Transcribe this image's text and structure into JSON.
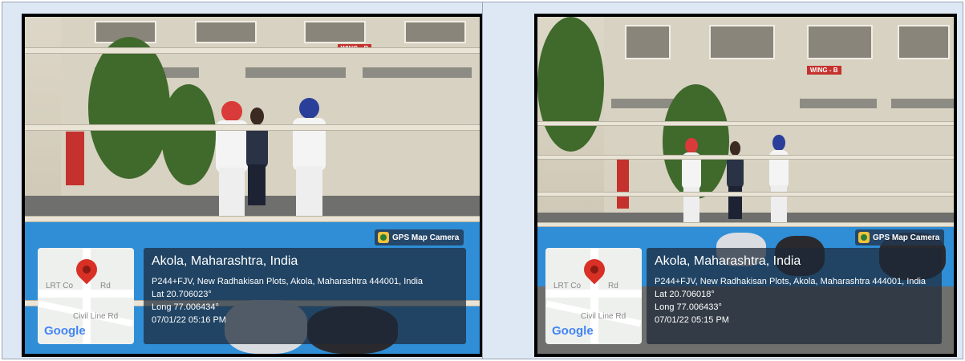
{
  "left": {
    "badge": "GPS Map Camera",
    "map": {
      "road1": "LRT Co",
      "road1b": "Rd",
      "road2": "Civil Line Rd",
      "google": "Google"
    },
    "location": "Akola, Maharashtra, India",
    "address": "P244+FJV, New Radhakisan Plots, Akola, Maharashtra 444001, India",
    "lat": "Lat 20.706023°",
    "long": "Long 77.006434°",
    "datetime": "07/01/22 05:16 PM",
    "sign": "WING - B"
  },
  "right": {
    "badge": "GPS Map Camera",
    "map": {
      "road1": "LRT Co",
      "road1b": "Rd",
      "road2": "Civil Line Rd",
      "google": "Google"
    },
    "location": "Akola, Maharashtra, India",
    "address": "P244+FJV, New Radhakisan Plots, Akola, Maharashtra 444001, India",
    "lat": "Lat 20.706018°",
    "long": "Long 77.006433°",
    "datetime": "07/01/22 05:15 PM",
    "sign": "WING - B"
  },
  "colors": {
    "mat": "#2f8ed6",
    "pin": "#d93025",
    "overlay": "#1c2837"
  }
}
